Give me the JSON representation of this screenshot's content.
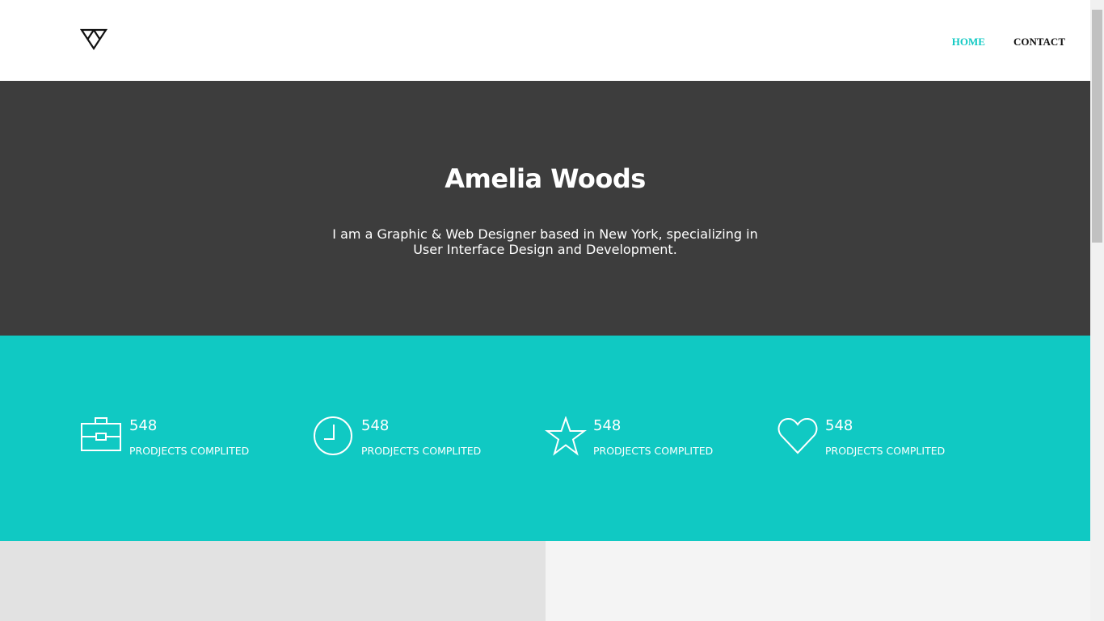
{
  "nav": {
    "home": "HOME",
    "contact": "CONTACT"
  },
  "hero": {
    "title": "Amelia Woods",
    "subtitle": "I am a Graphic & Web Designer based in New York, specializing in User Interface Design and Development."
  },
  "stats": [
    {
      "icon": "briefcase-icon",
      "number": "548",
      "label": "PRODJECTS COMPLITED"
    },
    {
      "icon": "clock-icon",
      "number": "548",
      "label": "PRODJECTS COMPLITED"
    },
    {
      "icon": "star-icon",
      "number": "548",
      "label": "PRODJECTS COMPLITED"
    },
    {
      "icon": "heart-icon",
      "number": "548",
      "label": "PRODJECTS COMPLITED"
    }
  ],
  "colors": {
    "accent": "#10c9c3",
    "hero_bg": "#3d3d3d"
  }
}
